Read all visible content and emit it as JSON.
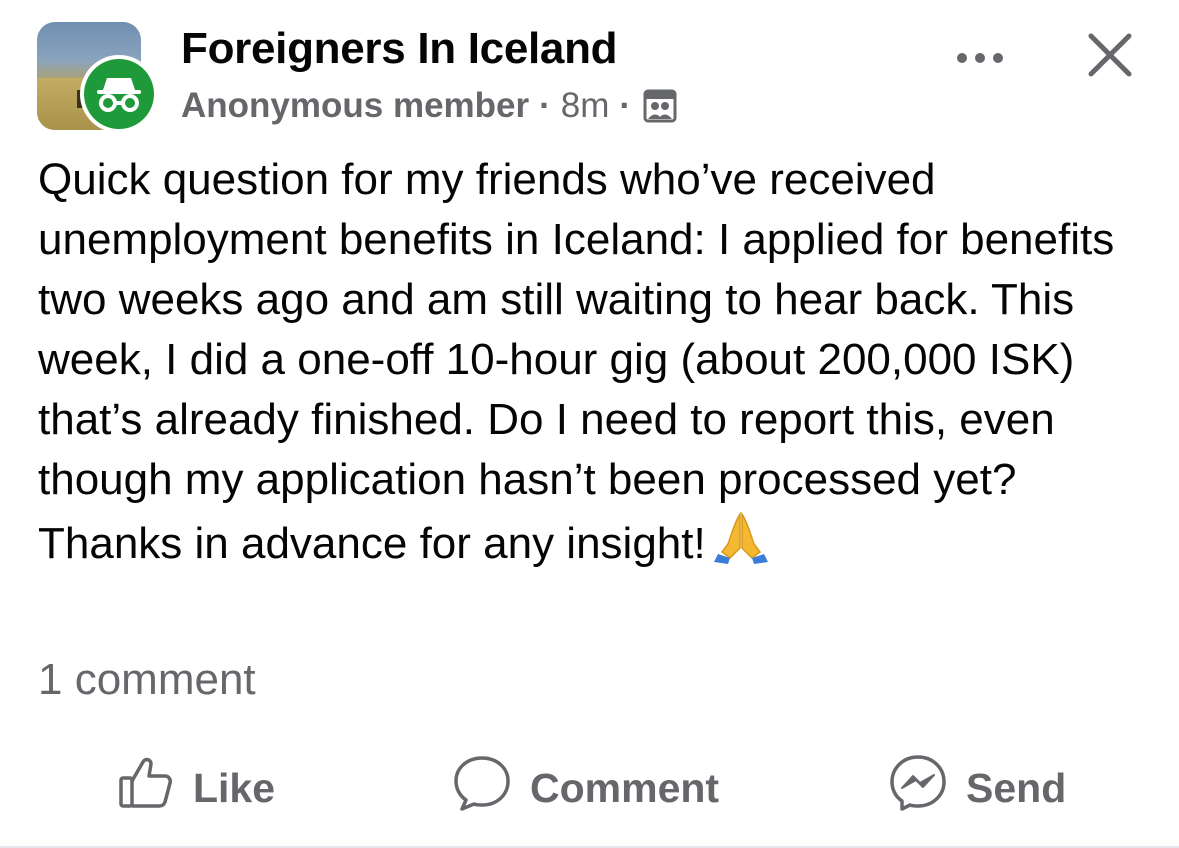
{
  "header": {
    "group_name": "Foreigners In Iceland",
    "author": "Anonymous member",
    "separator": "·",
    "time": "8m",
    "audience_icon": "group-members-icon",
    "more_icon": "more-icon",
    "close_icon": "close-icon",
    "avatar_icon": "incognito-icon"
  },
  "post": {
    "text": "Quick question for my friends who’ve received unemployment benefits in Iceland: I applied for benefits two weeks ago and am still waiting to hear back. This week, I did a one-off 10-hour gig (about 200,000 ISK) that’s already finished. Do I need to report this, even though my application hasn’t been processed yet? Thanks in advance for any insight!",
    "emoji": "folded-hands-emoji",
    "comment_count": "1 comment"
  },
  "actions": {
    "like_label": "Like",
    "comment_label": "Comment",
    "send_label": "Send"
  },
  "colors": {
    "text_primary": "#050505",
    "text_secondary": "#65676b",
    "anon_badge": "#1f9a3a",
    "divider": "#e4e6eb"
  }
}
